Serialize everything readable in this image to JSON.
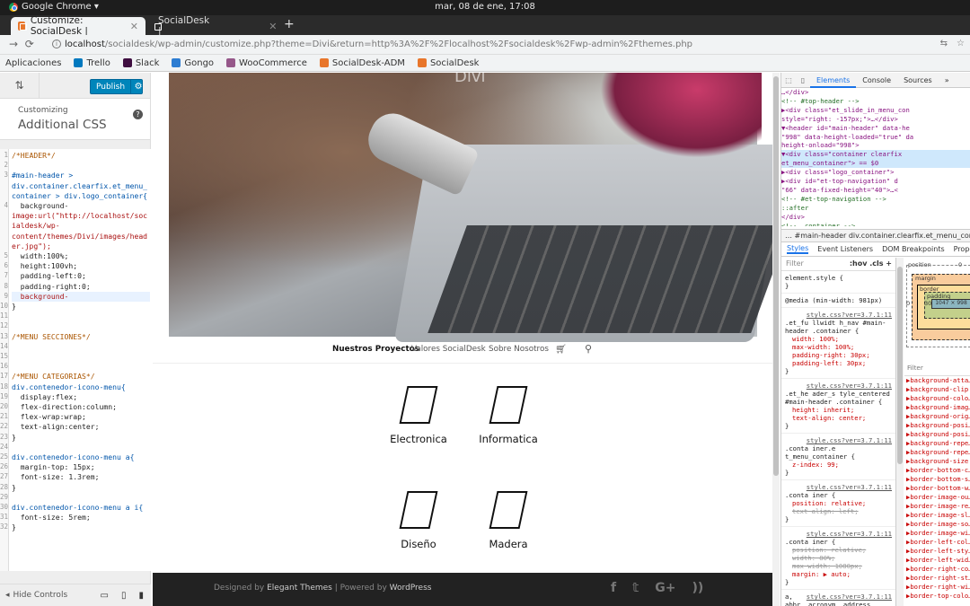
{
  "os": {
    "app": "Google Chrome ▾",
    "clock": "mar, 08 de ene, 17:08"
  },
  "tabs": [
    {
      "label": "Customize: SocialDesk |",
      "active": true
    },
    {
      "label": "SocialDesk |",
      "active": false
    }
  ],
  "omnibox": {
    "host": "localhost",
    "path": "/socialdesk/wp-admin/customize.php?theme=Divi&return=http%3A%2F%2Flocalhost%2Fsocialdesk%2Fwp-admin%2Fthemes.php"
  },
  "bookmarks": [
    {
      "label": "Aplicaciones",
      "color": "#4a6fd0"
    },
    {
      "label": "Trello",
      "color": "#0079bf"
    },
    {
      "label": "Slack",
      "color": "#3f0e40"
    },
    {
      "label": "Gongo",
      "color": "#2d7dd2"
    },
    {
      "label": "WooCommerce",
      "color": "#96588a"
    },
    {
      "label": "SocialDesk-ADM",
      "color": "#e8762b"
    },
    {
      "label": "SocialDesk",
      "color": "#e8762b"
    }
  ],
  "customizer": {
    "publish": "Publish",
    "section_small": "Customizing",
    "section_title": "Additional CSS",
    "hide_controls": "Hide Controls",
    "code_lines": [
      {
        "n": "1",
        "text": "/*HEADER*/"
      },
      {
        "n": "2",
        "text": ""
      },
      {
        "n": "3",
        "text": "#main-header >"
      },
      {
        "n": "",
        "text": "div.container.clearfix.et_menu_"
      },
      {
        "n": "",
        "text": "container > div.logo_container{"
      },
      {
        "n": "4",
        "text": "  background-"
      },
      {
        "n": "",
        "text": "image:url(\"http://localhost/soc"
      },
      {
        "n": "",
        "text": "ialdesk/wp-"
      },
      {
        "n": "",
        "text": "content/themes/Divi/images/head"
      },
      {
        "n": "",
        "text": "er.jpg\");"
      },
      {
        "n": "5",
        "text": "  width:100%;"
      },
      {
        "n": "6",
        "text": "  height:100vh;"
      },
      {
        "n": "7",
        "text": "  padding-left:0;"
      },
      {
        "n": "8",
        "text": "  padding-right:0;"
      },
      {
        "n": "9",
        "text": "  background-"
      },
      {
        "n": "10",
        "text": "}"
      },
      {
        "n": "11",
        "text": ""
      },
      {
        "n": "12",
        "text": ""
      },
      {
        "n": "13",
        "text": "/*MENU SECCIONES*/"
      },
      {
        "n": "14",
        "text": ""
      },
      {
        "n": "15",
        "text": ""
      },
      {
        "n": "16",
        "text": ""
      },
      {
        "n": "17",
        "text": "/*MENU CATEGORIAS*/"
      },
      {
        "n": "18",
        "text": "div.contenedor-icono-menu{"
      },
      {
        "n": "19",
        "text": "  display:flex;"
      },
      {
        "n": "20",
        "text": "  flex-direction:column;"
      },
      {
        "n": "21",
        "text": "  flex-wrap:wrap;"
      },
      {
        "n": "22",
        "text": "  text-align:center;"
      },
      {
        "n": "23",
        "text": "}"
      },
      {
        "n": "24",
        "text": ""
      },
      {
        "n": "25",
        "text": "div.contenedor-icono-menu a{"
      },
      {
        "n": "26",
        "text": "  margin-top: 15px;"
      },
      {
        "n": "27",
        "text": "  font-size: 1.3rem;"
      },
      {
        "n": "28",
        "text": "}"
      },
      {
        "n": "29",
        "text": ""
      },
      {
        "n": "30",
        "text": "div.contenedor-icono-menu a i{"
      },
      {
        "n": "31",
        "text": "  font-size: 5rem;"
      },
      {
        "n": "32",
        "text": "}"
      }
    ]
  },
  "site": {
    "nav": [
      "Nuestros Proyectos",
      "Valores SocialDesk",
      "Sobre Nosotros"
    ],
    "categories": [
      "Electronica",
      "Informatica",
      "Diseño",
      "Madera"
    ],
    "footer_prefix": "Designed by ",
    "footer_link1": "Elegant Themes",
    "footer_mid": " | Powered by ",
    "footer_link2": "WordPress",
    "logo": "Divi"
  },
  "devtools": {
    "tabs": [
      "Elements",
      "Console",
      "Sources",
      "»"
    ],
    "dom_lines": [
      "…</div>",
      "  <!-- #top-header -->",
      " ▶<div class=\"et_slide_in_menu_con",
      "  style=\"right: -157px;\">…</div>",
      " ▼<header id=\"main-header\" data-he",
      "  \"998\" data-height-loaded=\"true\" da",
      "  height-onload=\"998\">",
      "   ▼<div class=\"container clearfix",
      "   et_menu_container\"> == $0",
      "     ▶<div class=\"logo_container\">",
      "     ▶<div id=\"et-top-navigation\" d",
      "     \"66\" data-fixed-height=\"40\">…<",
      "       <!-- #et-top-navigation -->",
      "       ::after",
      "     </div>",
      "     <!-- .container -->"
    ],
    "crumbs": "…   #main-header    div.container.clearfix.et_menu_contain",
    "subtabs": [
      "Styles",
      "Event Listeners",
      "DOM Breakpoints",
      "Properties"
    ],
    "filter": "Filter",
    "filter_toggles": ":hov  .cls  +",
    "rules": [
      {
        "sel": "element.style {",
        "src": "",
        "props": [],
        "end": "}"
      },
      {
        "sel": "@media (min-width: 981px)",
        "src": "",
        "props": [],
        "end": ""
      },
      {
        "sel": ".et_fu llwidt h_nav #main-header .container {",
        "src": "style.css?ver=3.7.1:11",
        "props": [
          {
            "t": "width: 100%;",
            "s": false
          },
          {
            "t": "max-width: 100%;",
            "s": false
          },
          {
            "t": "padding-right: 30px;",
            "s": false
          },
          {
            "t": "padding-left: 30px;",
            "s": false
          }
        ],
        "end": "}"
      },
      {
        "sel": ".et_he ader_s tyle_centered #main-header .container {",
        "src": "style.css?ver=3.7.1:11",
        "props": [
          {
            "t": "height: inherit;",
            "s": false
          },
          {
            "t": "text-align: center;",
            "s": false
          }
        ],
        "end": "}"
      },
      {
        "sel": ".conta iner.e t_menu_container {",
        "src": "style.css?ver=3.7.1:11",
        "props": [
          {
            "t": "z-index: 99;",
            "s": false
          }
        ],
        "end": "}"
      },
      {
        "sel": ".conta iner {",
        "src": "style.css?ver=3.7.1:11",
        "props": [
          {
            "t": "position: relative;",
            "s": false
          },
          {
            "t": "text-align: left;",
            "s": true
          }
        ],
        "end": "}"
      },
      {
        "sel": ".conta iner {",
        "src": "style.css?ver=3.7.1:11",
        "props": [
          {
            "t": "position: relative;",
            "s": true
          },
          {
            "t": "width: 80%;",
            "s": true
          },
          {
            "t": "max-width: 1080px;",
            "s": true
          },
          {
            "t": "margin: ▶ auto;",
            "s": false
          }
        ],
        "end": "}"
      },
      {
        "sel": "a, abbr, acronym, address, applet, b, big, blockquote, body,",
        "src": "style.css?ver=3.7.1:11",
        "props": [],
        "end": ""
      }
    ],
    "boxmodel": {
      "position": "position",
      "margin": "margin",
      "border": "border",
      "padding": "padding",
      "content": "1047 × 998",
      "pos_val": "0",
      "pad_left": "30",
      "dash": "–"
    },
    "computed_filter": "Filter",
    "computed": [
      "background-atta…",
      "background-clip",
      "background-colo…",
      "background-imag…",
      "background-orig…",
      "background-posi…",
      "background-posi…",
      "background-repe…",
      "background-repe…",
      "background-size",
      "border-bottom-c…",
      "border-bottom-s…",
      "border-bottom-w…",
      "border-image-ou…",
      "border-image-re…",
      "border-image-sl…",
      "border-image-so…",
      "border-image-wi…",
      "border-left-col…",
      "border-left-sty…",
      "border-left-wid…",
      "border-right-co…",
      "border-right-st…",
      "border-right-wi…",
      "border-top-colo…"
    ]
  }
}
